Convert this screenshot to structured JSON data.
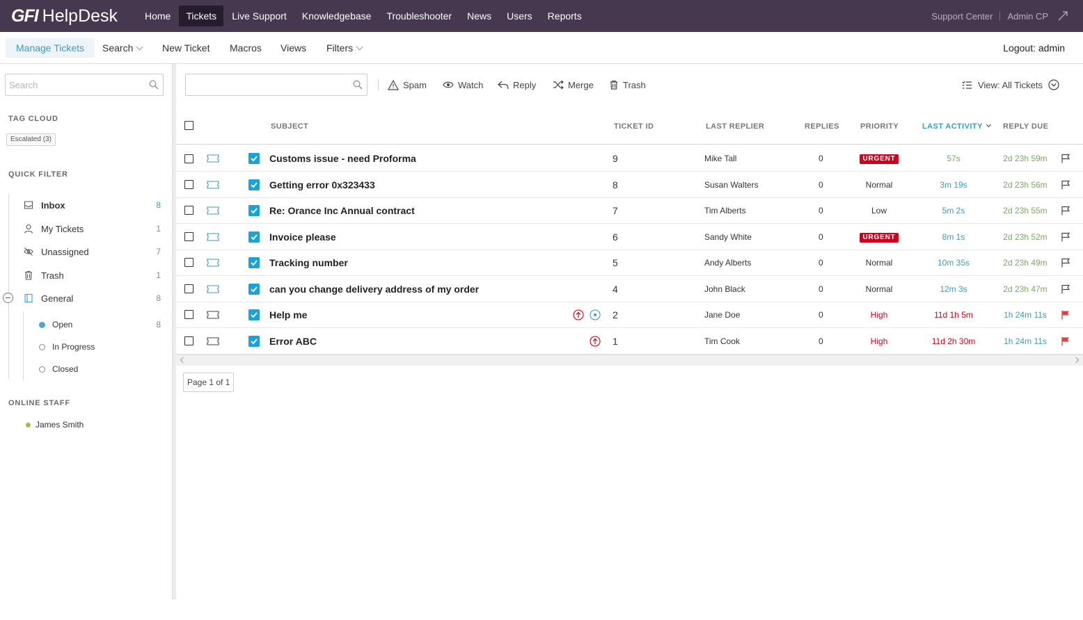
{
  "app": {
    "logo_brand": "GFI",
    "logo_product": "HelpDesk",
    "top_nav": [
      "Home",
      "Tickets",
      "Live Support",
      "Knowledgebase",
      "Troubleshooter",
      "News",
      "Users",
      "Reports"
    ],
    "top_nav_active": "Tickets",
    "support_center": "Support Center",
    "admin_cp": "Admin CP"
  },
  "subnav": {
    "manage_tickets": "Manage Tickets",
    "search": "Search",
    "new_ticket": "New Ticket",
    "macros": "Macros",
    "views": "Views",
    "filters": "Filters",
    "logout": "Logout: admin"
  },
  "sidebar": {
    "search_placeholder": "Search",
    "tag_cloud_title": "TAG CLOUD",
    "tag": "Escalated (3)",
    "quick_filter_title": "QUICK FILTER",
    "filters": [
      {
        "label": "Inbox",
        "count": "8",
        "icon": "inbox-icon"
      },
      {
        "label": "My Tickets",
        "count": "1",
        "icon": "user-icon"
      },
      {
        "label": "Unassigned",
        "count": "7",
        "icon": "eye-off-icon"
      },
      {
        "label": "Trash",
        "count": "1",
        "icon": "trash-icon"
      },
      {
        "label": "General",
        "count": "8",
        "icon": "folder-icon"
      }
    ],
    "statuses": [
      {
        "label": "Open",
        "count": "8"
      },
      {
        "label": "In Progress",
        "count": ""
      },
      {
        "label": "Closed",
        "count": ""
      }
    ],
    "online_staff_title": "ONLINE STAFF",
    "staff": "James Smith"
  },
  "toolbar": {
    "spam": "Spam",
    "watch": "Watch",
    "reply": "Reply",
    "merge": "Merge",
    "trash": "Trash",
    "view": "View: All Tickets"
  },
  "table": {
    "headers": {
      "subject": "SUBJECT",
      "ticket_id": "TICKET ID",
      "last_replier": "LAST REPLIER",
      "replies": "REPLIES",
      "priority": "PRIORITY",
      "last_activity": "LAST ACTIVITY",
      "reply_due": "REPLY DUE"
    },
    "rows": [
      {
        "subject": "Customs issue - need Proforma",
        "id": "9",
        "replier": "Mike Tall",
        "replies": "0",
        "priority": "URGENT",
        "activity": "57s",
        "due": "2d 23h 59m"
      },
      {
        "subject": "Getting error 0x323433",
        "id": "8",
        "replier": "Susan Walters",
        "replies": "0",
        "priority": "Normal",
        "activity": "3m 19s",
        "due": "2d 23h 56m"
      },
      {
        "subject": "Re: Orance Inc Annual contract",
        "id": "7",
        "replier": "Tim Alberts",
        "replies": "0",
        "priority": "Low",
        "activity": "5m 2s",
        "due": "2d 23h 55m"
      },
      {
        "subject": "Invoice please",
        "id": "6",
        "replier": "Sandy White",
        "replies": "0",
        "priority": "URGENT",
        "activity": "8m 1s",
        "due": "2d 23h 52m"
      },
      {
        "subject": "Tracking number",
        "id": "5",
        "replier": "Andy Alberts",
        "replies": "0",
        "priority": "Normal",
        "activity": "10m 35s",
        "due": "2d 23h 49m"
      },
      {
        "subject": "can you change delivery address of my order",
        "id": "4",
        "replier": "John Black",
        "replies": "0",
        "priority": "Normal",
        "activity": "12m 3s",
        "due": "2d 23h 47m"
      },
      {
        "subject": "Help me",
        "id": "2",
        "replier": "Jane Doe",
        "replies": "0",
        "priority": "High",
        "activity": "11d 1h 5m",
        "due": "1h 24m 11s"
      },
      {
        "subject": "Error ABC",
        "id": "1",
        "replier": "Tim Cook",
        "replies": "0",
        "priority": "High",
        "activity": "11d 2h 30m",
        "due": "1h 24m 11s"
      }
    ]
  },
  "pager": "Page 1 of 1",
  "colors": {
    "topbar": "#45384f",
    "accent": "#3e9ac4",
    "urgent": "#d0021b",
    "high": "#d0021b",
    "due_ok": "#7aa860",
    "due_late": "#3e9ac4",
    "activity": "#3e9ac4"
  }
}
